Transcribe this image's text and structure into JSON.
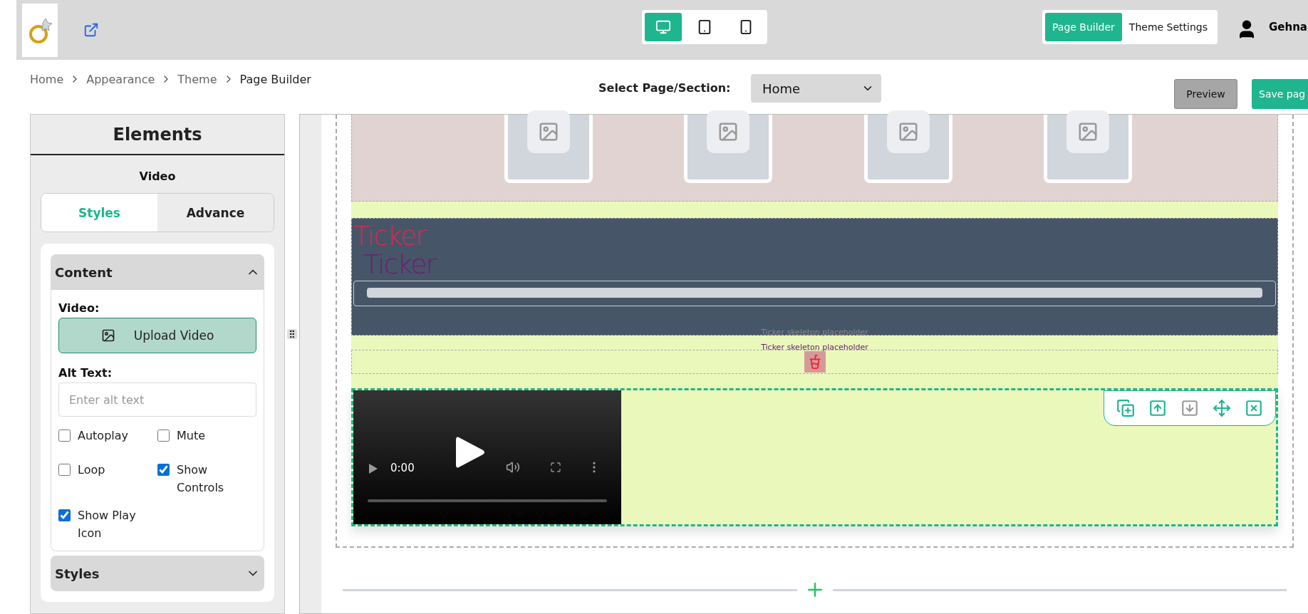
{
  "header": {
    "devices": [
      {
        "kind": "desktop",
        "selected": true
      },
      {
        "kind": "tablet",
        "selected": false
      },
      {
        "kind": "mobile",
        "selected": false
      }
    ],
    "modes": [
      {
        "label": "Page Builder",
        "selected": true
      },
      {
        "label": "Theme Settings",
        "selected": false
      }
    ],
    "user": "Gehna"
  },
  "breadcrumb": [
    "Home",
    "Appearance",
    "Theme",
    "Page Builder"
  ],
  "page_select": {
    "label": "Select Page/Section:",
    "value": "Home"
  },
  "actions": {
    "preview": "Preview",
    "save": "Save pag"
  },
  "sidebar": {
    "title": "Elements",
    "element": "Video",
    "tabs": [
      {
        "label": "Styles",
        "selected": true
      },
      {
        "label": "Advance",
        "selected": false
      }
    ],
    "sections": [
      {
        "title": "Content",
        "expanded": true
      },
      {
        "title": "Styles",
        "expanded": false
      }
    ],
    "video_label": "Video:",
    "upload_button": "Upload Video",
    "alt_label": "Alt Text:",
    "alt_placeholder": "Enter alt text",
    "options": [
      {
        "label": "Autoplay",
        "checked": false
      },
      {
        "label": "Mute",
        "checked": false
      },
      {
        "label": "Loop",
        "checked": false
      },
      {
        "label": "Show Controls",
        "checked": true
      },
      {
        "label": "Show Play Icon",
        "checked": true
      }
    ]
  },
  "canvas": {
    "ticker_titles": [
      "Ticker",
      "Ticker"
    ],
    "ticker_placeholders": [
      "Ticker skeleton placeholder",
      "Ticker skeleton placeholder"
    ],
    "video": {
      "time": "0:00"
    },
    "tools": [
      {
        "kind": "duplicate",
        "disabled": false
      },
      {
        "kind": "up",
        "disabled": false
      },
      {
        "kind": "down",
        "disabled": true
      },
      {
        "kind": "move",
        "disabled": false
      },
      {
        "kind": "remove",
        "disabled": false
      }
    ]
  }
}
